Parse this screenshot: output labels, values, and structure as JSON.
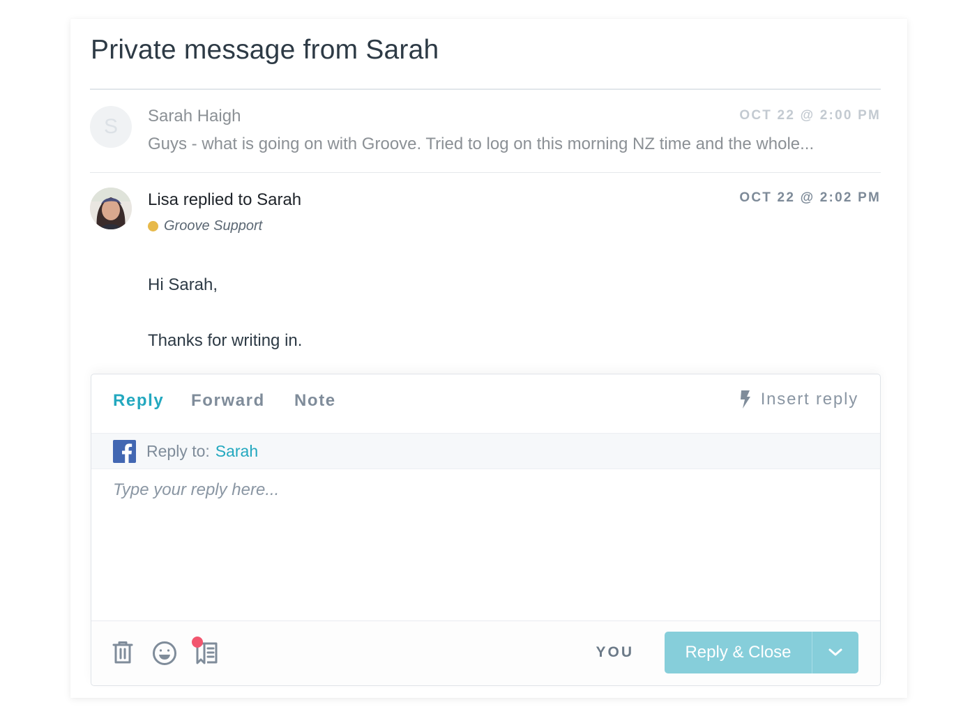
{
  "page": {
    "title": "Private message from Sarah"
  },
  "messages": [
    {
      "avatar_letter": "S",
      "author": "Sarah Haigh",
      "timestamp": "OCT 22 @ 2:00 PM",
      "preview": "Guys - what is going on with Groove. Tried to log on this morning NZ time and the whole..."
    },
    {
      "avatar": "agent-photo",
      "author": "Lisa replied to Sarah",
      "timestamp": "OCT 22 @ 2:02 PM",
      "team": "Groove Support",
      "team_color": "#e7b94a",
      "body": [
        "Hi Sarah,",
        "Thanks for writing in."
      ]
    }
  ],
  "composer": {
    "tabs": [
      {
        "label": "Reply",
        "active": true
      },
      {
        "label": "Forward",
        "active": false
      },
      {
        "label": "Note",
        "active": false
      }
    ],
    "insert_reply_label": "Insert reply",
    "recipient": {
      "channel_icon": "facebook-icon",
      "label": "Reply to:",
      "name": "Sarah"
    },
    "input": {
      "value": "",
      "placeholder": "Type your reply here..."
    },
    "footer": {
      "icons": [
        "trash-icon",
        "emoji-icon",
        "knowledge-base-icon"
      ],
      "assignee_label": "YOU",
      "send_label": "Reply & Close"
    }
  },
  "colors": {
    "accent": "#23a8bf",
    "send_button": "#86ceda",
    "notification": "#f2566f",
    "facebook": "#4267b2"
  }
}
